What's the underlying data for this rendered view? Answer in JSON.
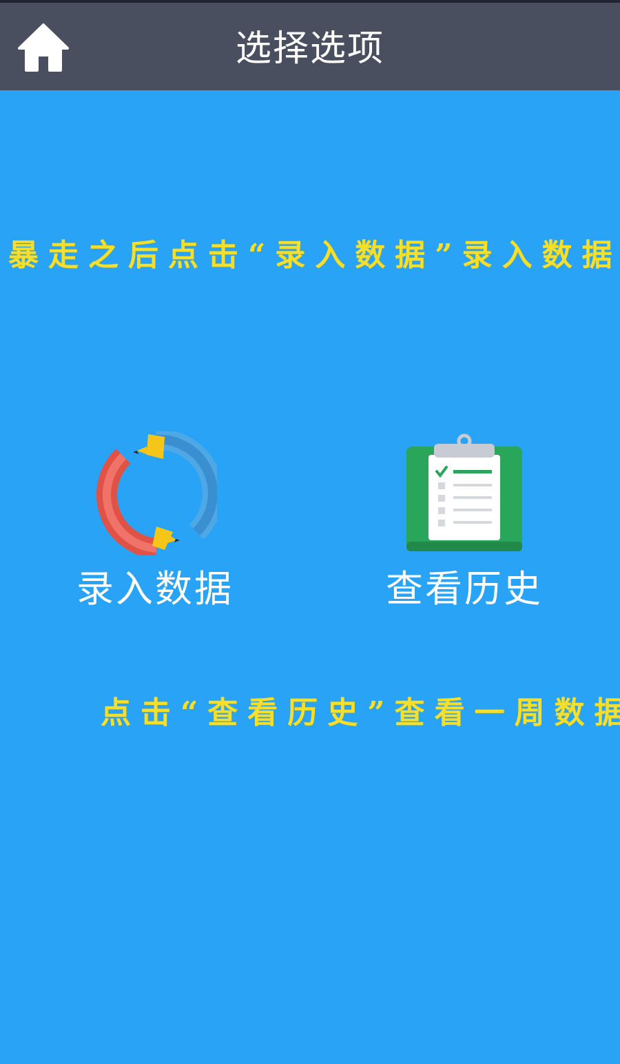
{
  "header": {
    "title": "选择选项",
    "home_icon": "home-icon"
  },
  "hints": {
    "top": "暴走之后点击“录入数据”录入数据",
    "bottom": "点击“查看历史”查看一周数据"
  },
  "tiles": [
    {
      "label": "录入数据",
      "icon": "pencil-cycle-icon"
    },
    {
      "label": "查看历史",
      "icon": "clipboard-checklist-icon"
    }
  ],
  "colors": {
    "background": "#28a3f5",
    "header": "#4a4f60",
    "hint_text": "#f3df2c",
    "label_text": "#ffffff"
  }
}
